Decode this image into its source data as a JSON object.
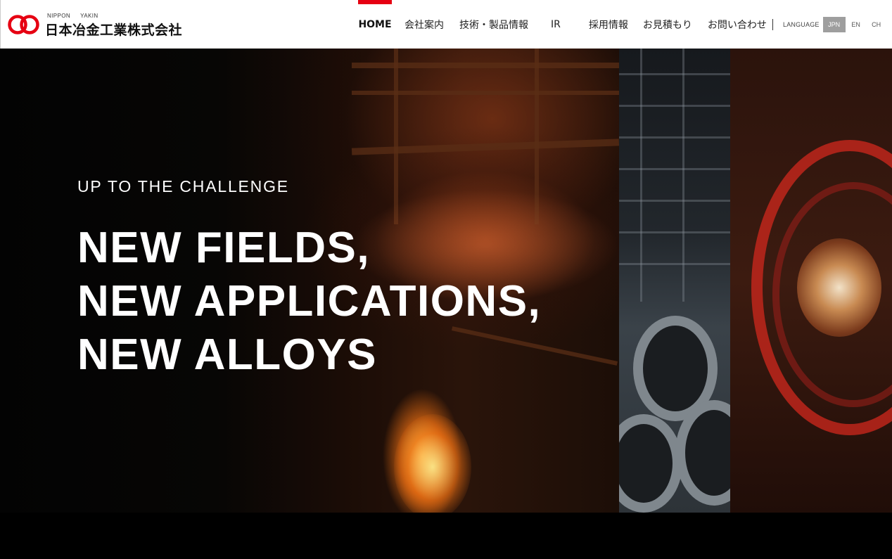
{
  "header": {
    "logo_romaji": [
      "NIPPON",
      "YAKIN"
    ],
    "logo_jp": "日本冶金工業株式会社",
    "nav": [
      {
        "label": "HOME",
        "active": true
      },
      {
        "label": "会社案内"
      },
      {
        "label": "技術・製品情報"
      },
      {
        "label": "IR"
      },
      {
        "label": "採用情報"
      },
      {
        "label": "お見積もり"
      },
      {
        "label": "お問い合わせ"
      }
    ],
    "language_label": "LANGUAGE",
    "languages": [
      {
        "label": "JPN",
        "active": true
      },
      {
        "label": "EN"
      },
      {
        "label": "CH"
      }
    ]
  },
  "hero": {
    "subtitle": "UP TO THE CHALLENGE",
    "title_lines": [
      "NEW FIELDS,",
      "NEW APPLICATIONS,",
      "NEW ALLOYS"
    ]
  },
  "colors": {
    "brand_red": "#e60012",
    "active_lang_bg": "#9e9e9e"
  }
}
